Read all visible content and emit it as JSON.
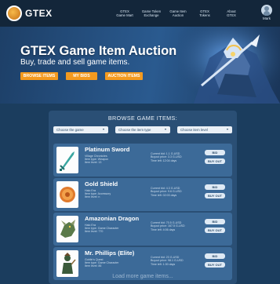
{
  "header": {
    "logo_text": "GTEX",
    "nav": [
      {
        "line1": "GTEX",
        "line2": "Game Mart"
      },
      {
        "line1": "Game Token",
        "line2": "Exchange"
      },
      {
        "line1": "Game Item",
        "line2": "Auction"
      },
      {
        "line1": "GTEX",
        "line2": "Tokens"
      },
      {
        "line1": "About",
        "line2": "GTEX"
      }
    ],
    "user_label": "Mark"
  },
  "hero": {
    "title": "GTEX Game Item Auction",
    "subtitle": "Buy, trade and sell game items.",
    "buttons": [
      "BROWSE ITEMS",
      "MY BIDS",
      "AUCTION ITEMS"
    ]
  },
  "browse": {
    "title": "BROWSE GAME ITEMS:",
    "filters": [
      "Choose the game",
      "Choose the item type",
      "Choose item level"
    ],
    "load_more": "Load more game items..."
  },
  "items": [
    {
      "name": "Platinum Sword",
      "desc": [
        "Village Chronicles",
        "Item type: Weapon",
        "Item level: 13"
      ],
      "price": [
        "Current bid: 1.1 G-USD",
        "Buyout price: 3.3 G-USD",
        "Time left: 12:04 days"
      ],
      "bid_label": "BID",
      "buy_label": "BUY OUT",
      "icon": "sword-icon",
      "accent": "#3aa6a0"
    },
    {
      "name": "Gold Shield",
      "desc": [
        "Halo Era",
        "Item type: Accessory",
        "Item level: n"
      ],
      "price": [
        "Current bid: 4.3 G-USD",
        "Buyout price: 9.6 G-USD",
        "Time left: 02:03 days"
      ],
      "bid_label": "BID",
      "buy_label": "BUY OUT",
      "icon": "shield-icon",
      "accent": "#e07a2c"
    },
    {
      "name": "Amazonian Dragon",
      "desc": [
        "Halo Era",
        "Item type: Game Character",
        "Item level: 770"
      ],
      "price": [
        "Current bid: 70.5 G-USD",
        "Buyout price: 167.5 G-USD",
        "Time left: 4:06 days"
      ],
      "bid_label": "BID",
      "buy_label": "BUY OUT",
      "icon": "dragon-icon",
      "accent": "#5a7a4a"
    },
    {
      "name": "Mr. Phillips (Elite)",
      "desc": [
        "Goblin's Quest",
        "Item type: Game Character",
        "Item level: 86"
      ],
      "price": [
        "Current bid: 23 G-USD",
        "Buyout price: 98.1 G-USD",
        "Time left: 1:30 days"
      ],
      "bid_label": "BID",
      "buy_label": "BUY OUT",
      "icon": "character-icon",
      "accent": "#3a5a3a"
    }
  ],
  "colors": {
    "page_bg": "#1b3d5e",
    "topbar": "#13263a",
    "accent_orange": "#f39a1f",
    "panel": "#2a4f75",
    "item_row": "#3c6a98"
  }
}
